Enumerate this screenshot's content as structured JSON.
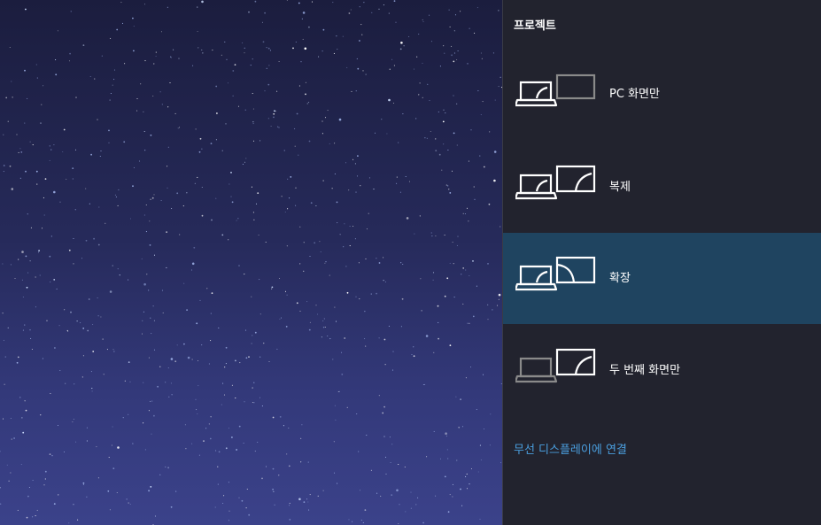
{
  "panel": {
    "title": "프로젝트",
    "options": [
      {
        "label": "PC 화면만",
        "icon": "pc-screen-only-icon",
        "selected": false
      },
      {
        "label": "복제",
        "icon": "duplicate-icon",
        "selected": false
      },
      {
        "label": "확장",
        "icon": "extend-icon",
        "selected": true
      },
      {
        "label": "두 번째 화면만",
        "icon": "second-screen-only-icon",
        "selected": false
      }
    ],
    "wireless_link": "무선 디스플레이에 연결"
  },
  "colors": {
    "panel_bg": "#22232e",
    "selected_bg": "#1f4460",
    "link": "#4a9ede",
    "icon_active": "#ffffff",
    "icon_dim": "#8a8a8a"
  }
}
